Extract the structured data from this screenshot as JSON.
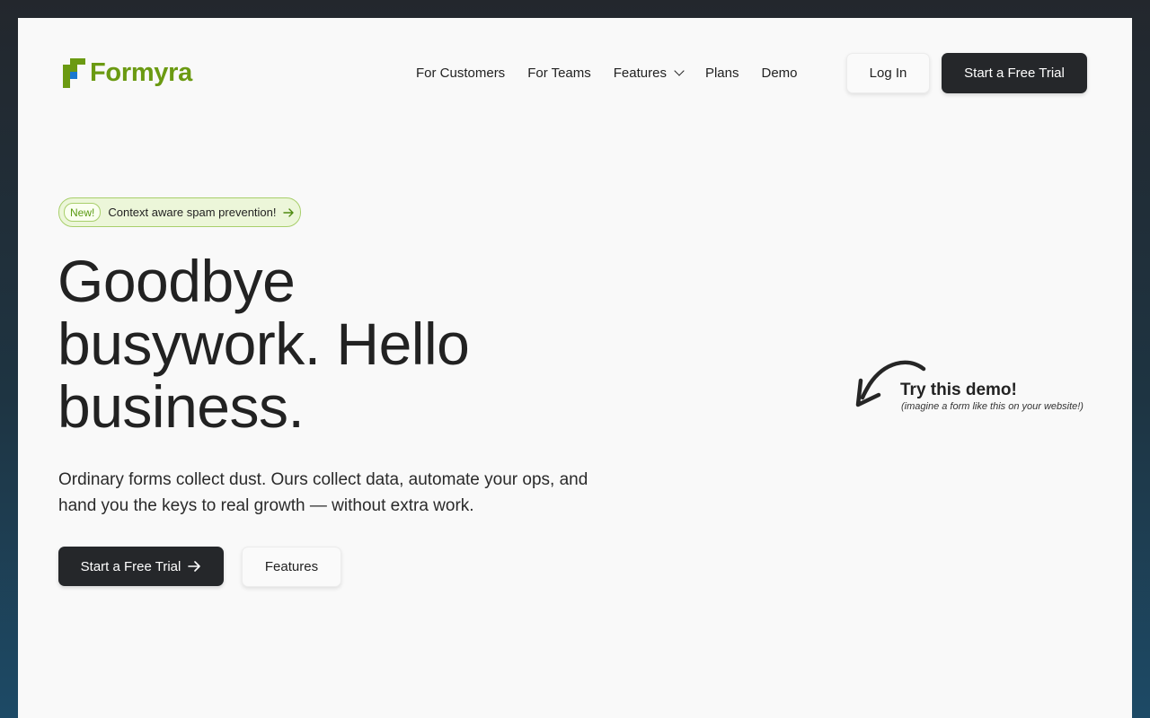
{
  "brand": {
    "name": "Formyra",
    "logo_icon": "formyra-logo-icon",
    "colors": {
      "primary_green": "#6b9a12",
      "accent_blue": "#1a78d0",
      "dark_button": "#25272a"
    }
  },
  "nav": {
    "items": [
      {
        "label": "For Customers"
      },
      {
        "label": "For Teams"
      },
      {
        "label": "Features",
        "has_dropdown": true
      },
      {
        "label": "Plans"
      },
      {
        "label": "Demo"
      }
    ]
  },
  "header": {
    "login_label": "Log In",
    "trial_label": "Start a Free Trial"
  },
  "badge": {
    "tag": "New!",
    "text": "Context aware spam prevention!",
    "icon": "arrow-right-icon"
  },
  "hero": {
    "headline_line1": "Goodbye",
    "headline_line2": "busywork. Hello",
    "headline_line3": "business.",
    "subtext": "Ordinary forms collect dust. Ours collect data, automate your ops, and hand you the keys to real growth — without extra work.",
    "primary_cta": "Start a Free Trial",
    "primary_cta_icon": "arrow-right-icon",
    "secondary_cta": "Features"
  },
  "demo": {
    "title": "Try this demo!",
    "subtitle": "(imagine a form like this on your website!)",
    "icon": "curved-arrow-icon"
  }
}
